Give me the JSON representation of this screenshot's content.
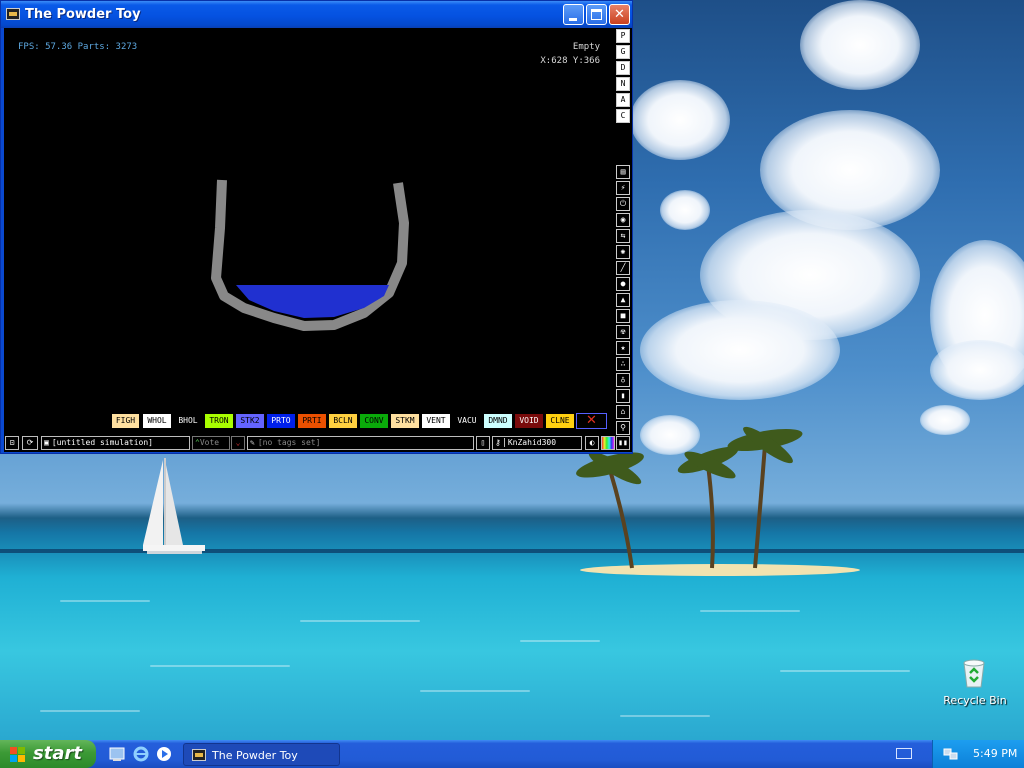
{
  "window": {
    "title": "The Powder Toy"
  },
  "hud": {
    "fps_text": "FPS: 57.36 Parts: 3273",
    "hover_element": "Empty",
    "coords": "X:628 Y:366"
  },
  "side_top": [
    "P",
    "G",
    "D",
    "N",
    "A",
    "C"
  ],
  "side_menu_icons": [
    "walls-icon",
    "electronics-icon",
    "powered-icon",
    "sensors-icon",
    "force-icon",
    "explosives-icon",
    "gases-icon",
    "liquids-icon",
    "powders-icon",
    "solids-icon",
    "radioactive-icon",
    "special-icon",
    "life-icon",
    "tools-icon",
    "favorites-icon",
    "decoration-icon",
    "search-icon"
  ],
  "elements": [
    {
      "label": "FIGH",
      "bg": "#ffe0a0",
      "fg": "#000000"
    },
    {
      "label": "WHOL",
      "bg": "#ffffff",
      "fg": "#000000"
    },
    {
      "label": "BHOL",
      "bg": "#000000",
      "fg": "#ffffff"
    },
    {
      "label": "TRON",
      "bg": "#a9ff00",
      "fg": "#000000"
    },
    {
      "label": "STK2",
      "bg": "#6464ff",
      "fg": "#000000"
    },
    {
      "label": "PRTO",
      "bg": "#0020eb",
      "fg": "#ffffff"
    },
    {
      "label": "PRTI",
      "bg": "#eb5000",
      "fg": "#000000"
    },
    {
      "label": "BCLN",
      "bg": "#ffd040",
      "fg": "#000000"
    },
    {
      "label": "CONV",
      "bg": "#0aab0a",
      "fg": "#000000"
    },
    {
      "label": "STKM",
      "bg": "#ffe0a0",
      "fg": "#000000"
    },
    {
      "label": "VENT",
      "bg": "#ffffff",
      "fg": "#000000"
    },
    {
      "label": "VACU",
      "bg": "#000000",
      "fg": "#ffffff"
    },
    {
      "label": "DMND",
      "bg": "#ccffff",
      "fg": "#000000"
    },
    {
      "label": "VOID",
      "bg": "#790b0b",
      "fg": "#ffffff"
    },
    {
      "label": "CLNE",
      "bg": "#ffd010",
      "fg": "#000000"
    }
  ],
  "bottombar": {
    "sim_name": "[untitled simulation]",
    "vote_label": "Vote",
    "tags": "[no tags set]",
    "username": "KnZahid300"
  },
  "taskbar": {
    "start_label": "start",
    "task_label": "The Powder Toy",
    "clock": "5:49 PM"
  },
  "desktop": {
    "recycle_bin_label": "Recycle Bin"
  },
  "colors": {
    "wall_gray": "#888888",
    "water_blue": "#2030d0",
    "title_blue": "#0552e1",
    "start_green": "#3c9a36"
  }
}
